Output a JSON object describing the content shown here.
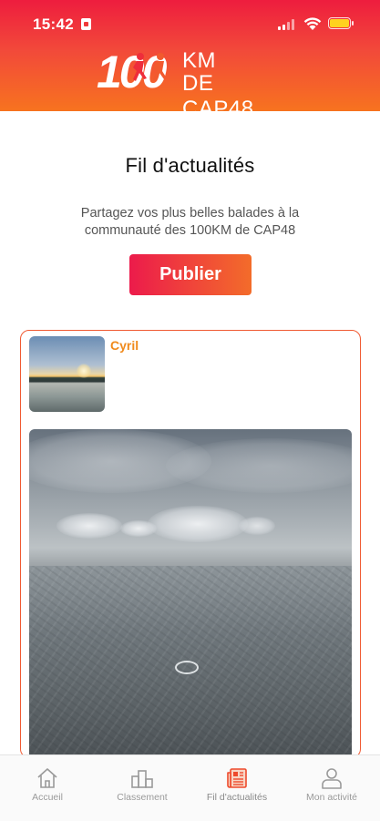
{
  "status_bar": {
    "time": "15:42"
  },
  "logo": {
    "number": "100",
    "line1": "KM",
    "line2": "DE CAP48"
  },
  "feed": {
    "title": "Fil d'actualités",
    "subtitle": "Partagez vos plus belles balades à la communauté des 100KM de CAP48",
    "publish_label": "Publier"
  },
  "post": {
    "author": "Cyril"
  },
  "tabbar": {
    "items": [
      {
        "label": "Accueil",
        "icon": "home-icon"
      },
      {
        "label": "Classement",
        "icon": "podium-icon"
      },
      {
        "label": "Fil d'actualités",
        "icon": "newsfeed-icon",
        "active": true
      },
      {
        "label": "Mon activité",
        "icon": "user-icon"
      }
    ]
  },
  "colors": {
    "brand_red": "#ee1d3e",
    "brand_orange": "#f7731f",
    "author_orange": "#f08a1c"
  }
}
